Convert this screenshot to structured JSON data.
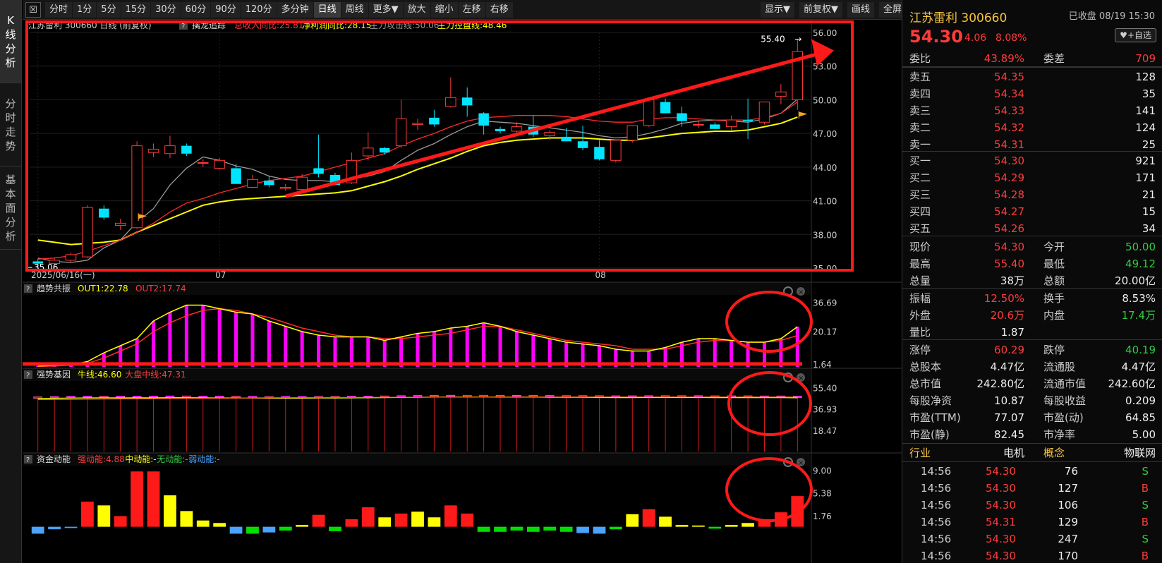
{
  "sidetabs": [
    {
      "label": "K线分析",
      "chars": [
        "K",
        "线",
        "分",
        "析"
      ],
      "active": true
    },
    {
      "label": "分时走势",
      "chars": [
        "分",
        "时",
        "走",
        "势"
      ],
      "active": false
    },
    {
      "label": "基本面分析",
      "chars": [
        "基",
        "本",
        "面",
        "分",
        "析"
      ],
      "active": false
    }
  ],
  "toolbar": {
    "left": [
      "分时",
      "1分",
      "5分",
      "15分",
      "30分",
      "60分",
      "90分",
      "120分",
      "多分钟",
      "日线",
      "周线",
      "更多▼",
      "放大",
      "缩小",
      "左移",
      "右移"
    ],
    "active": "日线",
    "right": [
      "显示▼",
      "前复权▼",
      "画线",
      "全屏"
    ]
  },
  "main": {
    "title": "江苏雷利 300660 日线 (前复权)",
    "indicator_name": "擒龙追踪",
    "indicator_items": [
      {
        "label": "总收入同比:25.81",
        "color": "#ff3b3b"
      },
      {
        "label": "净利润同比:28.15",
        "color": "#ffff00"
      },
      {
        "label": "主力攻击线:50.06",
        "color": "#999999"
      },
      {
        "label": "主力控盘线:48.46",
        "color": "#ffff00"
      }
    ],
    "price_axis": [
      "56.00",
      "53.00",
      "50.00",
      "47.00",
      "44.00",
      "41.00",
      "38.00",
      "35.00"
    ],
    "high_label": "55.40",
    "low_label": "35.06",
    "date_labels": [
      "2025/06/16(一)",
      "07",
      "08"
    ]
  },
  "panel1": {
    "name": "趋势共振",
    "items": [
      {
        "label": "OUT1:22.78",
        "color": "#ffff00"
      },
      {
        "label": "OUT2:17.74",
        "color": "#ff3b3b"
      }
    ],
    "axis": [
      "36.69",
      "20.17",
      "1.64"
    ]
  },
  "panel2": {
    "name": "强势基因",
    "items": [
      {
        "label": "牛线:46.60",
        "color": "#ffff00"
      },
      {
        "label": "大盘中线:47.31",
        "color": "#ff3b3b"
      }
    ],
    "axis": [
      "55.40",
      "36.93",
      "18.47"
    ]
  },
  "panel3": {
    "name": "资金动能",
    "items": [
      {
        "label": "强动能:4.88",
        "color": "#ff3b3b"
      },
      {
        "label": "中动能:-",
        "color": "#ffff00"
      },
      {
        "label": "无动能:-",
        "color": "#2ecc40"
      },
      {
        "label": "弱动能:-",
        "color": "#4aa3ff"
      }
    ],
    "axis": [
      "9.00",
      "5.38",
      "1.76"
    ]
  },
  "chart_data": [
    {
      "type": "candlestick",
      "title": "江苏雷利 300660 日线 (前复权)",
      "ylim": [
        35.0,
        56.0
      ],
      "ohlc": [
        [
          35.6,
          35.8,
          35.06,
          35.4
        ],
        [
          35.4,
          35.9,
          35.1,
          35.7
        ],
        [
          35.7,
          36.4,
          35.5,
          36.2
        ],
        [
          36.0,
          40.6,
          35.9,
          40.4
        ],
        [
          40.3,
          40.6,
          39.3,
          39.5
        ],
        [
          38.8,
          39.4,
          38.4,
          39.0
        ],
        [
          38.6,
          46.3,
          38.5,
          45.9
        ],
        [
          45.3,
          46.1,
          44.9,
          45.6
        ],
        [
          45.2,
          46.8,
          44.8,
          45.9
        ],
        [
          45.9,
          46.1,
          45.0,
          45.2
        ],
        [
          44.4,
          44.7,
          44.0,
          44.4
        ],
        [
          43.9,
          44.8,
          43.8,
          44.6
        ],
        [
          43.9,
          44.3,
          42.6,
          42.5
        ],
        [
          42.2,
          43.3,
          42.1,
          42.9
        ],
        [
          42.8,
          43.2,
          42.2,
          42.4
        ],
        [
          42.1,
          42.5,
          41.9,
          42.2
        ],
        [
          42.0,
          43.4,
          41.9,
          43.1
        ],
        [
          43.9,
          46.9,
          43.1,
          43.4
        ],
        [
          43.3,
          43.5,
          42.5,
          42.4
        ],
        [
          42.6,
          45.3,
          42.5,
          44.6
        ],
        [
          45.0,
          47.1,
          44.6,
          45.7
        ],
        [
          45.7,
          45.8,
          45.1,
          45.3
        ],
        [
          45.9,
          50.0,
          45.7,
          48.3
        ],
        [
          47.8,
          48.3,
          47.3,
          47.9
        ],
        [
          48.4,
          49.1,
          47.6,
          47.8
        ],
        [
          49.4,
          52.0,
          49.3,
          50.2
        ],
        [
          50.2,
          51.1,
          48.5,
          49.5
        ],
        [
          48.8,
          48.9,
          46.9,
          47.7
        ],
        [
          47.4,
          47.6,
          47.0,
          47.2
        ],
        [
          47.2,
          48.0,
          47.0,
          47.6
        ],
        [
          47.6,
          48.6,
          46.7,
          46.9
        ],
        [
          46.8,
          47.3,
          46.4,
          47.1
        ],
        [
          46.7,
          47.5,
          46.3,
          46.3
        ],
        [
          46.3,
          47.7,
          45.5,
          45.7
        ],
        [
          45.8,
          46.4,
          44.6,
          44.7
        ],
        [
          44.6,
          46.4,
          44.4,
          46.4
        ],
        [
          46.4,
          47.6,
          46.2,
          47.7
        ],
        [
          47.7,
          50.0,
          47.6,
          50.0
        ],
        [
          49.8,
          50.1,
          48.9,
          48.8
        ],
        [
          48.8,
          49.4,
          47.6,
          48.1
        ],
        [
          47.8,
          48.2,
          47.5,
          47.8
        ],
        [
          47.8,
          48.0,
          47.4,
          47.4
        ],
        [
          47.6,
          48.6,
          47.3,
          48.2
        ],
        [
          48.2,
          50.1,
          46.5,
          48.1
        ],
        [
          48.0,
          49.8,
          47.8,
          49.8
        ],
        [
          50.3,
          51.4,
          49.6,
          50.7
        ],
        [
          50.0,
          55.4,
          49.1,
          54.3
        ]
      ],
      "series": [
        {
          "name": "主力攻击线",
          "values": [
            35.9,
            35.6,
            35.5,
            35.7,
            36.8,
            37.5,
            39.1,
            40.3,
            42.4,
            43.9,
            44.9,
            44.6,
            44.1,
            43.8,
            43.2,
            42.9,
            42.8,
            42.8,
            42.7,
            43.0,
            43.2,
            43.6,
            44.6,
            45.5,
            46.1,
            46.9,
            47.6,
            48.1,
            48.0,
            47.9,
            47.7,
            47.5,
            47.3,
            47.1,
            46.8,
            46.6,
            46.7,
            47.0,
            47.4,
            47.9,
            48.1,
            48.2,
            48.1,
            48.0,
            48.3,
            48.8,
            50.06
          ]
        },
        {
          "name": "主力控盘线",
          "values": [
            37.5,
            37.3,
            37.1,
            37.2,
            37.3,
            37.5,
            38.2,
            38.8,
            39.4,
            40.0,
            40.6,
            40.9,
            41.1,
            41.2,
            41.3,
            41.4,
            41.5,
            41.6,
            41.7,
            41.9,
            42.3,
            42.7,
            43.2,
            43.8,
            44.3,
            44.8,
            45.4,
            45.9,
            46.2,
            46.4,
            46.5,
            46.6,
            46.6,
            46.6,
            46.5,
            46.4,
            46.4,
            46.6,
            46.8,
            47.0,
            47.1,
            47.2,
            47.2,
            47.3,
            47.6,
            47.9,
            48.46
          ]
        },
        {
          "name": "趋势线",
          "values": [
            35.8,
            35.9,
            36.1,
            36.5,
            37.0,
            37.5,
            38.2,
            39.0,
            40.0,
            40.8,
            41.2,
            41.7,
            42.1,
            42.5,
            42.8,
            43.0,
            43.2,
            43.6,
            44.0,
            44.4,
            44.8,
            45.2,
            45.9,
            46.5,
            47.0,
            47.6,
            48.1,
            48.4,
            48.5,
            48.6,
            48.6,
            48.6,
            48.5,
            48.3,
            48.1,
            48.0,
            48.0,
            48.3,
            48.4,
            48.4,
            48.3,
            48.2,
            48.2,
            48.2,
            48.4,
            48.8,
            49.8
          ]
        }
      ]
    },
    {
      "type": "bar",
      "title": "趋势共振",
      "ylim": [
        0,
        40
      ],
      "series": [
        {
          "name": "OUT1",
          "values": [
            0.5,
            0.8,
            1.2,
            3,
            8,
            12,
            16,
            26,
            31,
            35,
            35,
            33,
            31,
            30,
            26,
            23,
            20,
            18,
            17,
            17,
            17,
            15,
            17,
            19,
            20,
            22,
            23,
            25,
            23,
            20,
            18,
            16,
            14,
            13,
            12,
            10,
            9,
            9,
            11,
            14,
            16,
            16,
            15,
            14,
            14,
            16,
            22.78
          ]
        },
        {
          "name": "OUT2",
          "values": [
            0.2,
            0.5,
            0.9,
            2,
            5,
            9,
            13,
            20,
            25,
            29,
            32,
            33,
            32,
            30,
            28,
            25,
            22,
            20,
            18,
            17,
            17,
            16,
            16,
            17,
            18,
            19,
            21,
            23,
            23,
            21,
            19,
            17,
            15,
            14,
            13,
            12,
            10,
            10,
            10,
            12,
            14,
            15,
            15,
            14,
            14,
            15,
            17.74
          ]
        }
      ]
    },
    {
      "type": "bar",
      "title": "强势基因",
      "ylim": [
        0,
        60
      ],
      "series": [
        {
          "name": "牛线",
          "values": [
            46,
            46.2,
            46.4,
            46.5,
            46.6,
            46.5,
            46.6,
            46.6,
            46.7,
            46.7,
            46.6,
            46.5,
            46.5,
            46.4,
            46.3,
            46.3,
            46.3,
            46.4,
            46.4,
            46.5,
            46.6,
            46.7,
            46.9,
            47.1,
            47.2,
            47.3,
            47.3,
            47.3,
            47.2,
            47.2,
            47.2,
            47.1,
            47,
            47,
            46.9,
            46.8,
            46.8,
            46.9,
            46.9,
            46.9,
            46.9,
            46.8,
            46.8,
            46.8,
            46.7,
            46.7,
            46.6
          ]
        },
        {
          "name": "大盘中线",
          "values": [
            45,
            45.1,
            45.2,
            45.4,
            45.6,
            45.7,
            45.8,
            45.9,
            46,
            46.1,
            46.2,
            46.3,
            46.4,
            46.5,
            46.6,
            46.7,
            46.8,
            46.8,
            46.9,
            46.9,
            47,
            47,
            47.1,
            47.1,
            47.2,
            47.2,
            47.2,
            47.3,
            47.3,
            47.3,
            47.3,
            47.3,
            47.3,
            47.3,
            47.3,
            47.3,
            47.3,
            47.3,
            47.3,
            47.3,
            47.3,
            47.3,
            47.3,
            47.3,
            47.3,
            47.3,
            47.31
          ]
        }
      ]
    },
    {
      "type": "bar",
      "title": "资金动能",
      "ylim": [
        -1.5,
        9.5
      ],
      "values": [
        -1.1,
        -0.4,
        -0.2,
        4.0,
        3.4,
        1.7,
        8.8,
        8.8,
        5.0,
        2.5,
        1.0,
        0.6,
        -1.1,
        -1.1,
        -0.9,
        -0.6,
        0.3,
        1.9,
        -0.7,
        1.2,
        3.1,
        1.5,
        2.1,
        2.4,
        1.5,
        3.4,
        2.1,
        -0.8,
        -0.8,
        -0.6,
        -0.8,
        -0.6,
        -0.8,
        -1.0,
        -1.1,
        -0.4,
        2.0,
        2.8,
        1.6,
        0.3,
        0.2,
        -0.3,
        0.3,
        0.6,
        1.1,
        2.3,
        4.88
      ]
    }
  ],
  "quote": {
    "name": "江苏雷利 300660",
    "date": "已收盘 08/19 15:30",
    "fav": "+自选",
    "price": "54.30",
    "change": "4.06",
    "pct": "8.08%",
    "weibi_label": "委比",
    "weibi": "43.89%",
    "weicha_label": "委差",
    "weicha": "709",
    "asks": [
      {
        "label": "卖五",
        "price": "54.35",
        "vol": "128"
      },
      {
        "label": "卖四",
        "price": "54.34",
        "vol": "35"
      },
      {
        "label": "卖三",
        "price": "54.33",
        "vol": "141"
      },
      {
        "label": "卖二",
        "price": "54.32",
        "vol": "124"
      },
      {
        "label": "卖一",
        "price": "54.31",
        "vol": "25"
      }
    ],
    "bids": [
      {
        "label": "买一",
        "price": "54.30",
        "vol": "921"
      },
      {
        "label": "买二",
        "price": "54.29",
        "vol": "171"
      },
      {
        "label": "买三",
        "price": "54.28",
        "vol": "21"
      },
      {
        "label": "买四",
        "price": "54.27",
        "vol": "15"
      },
      {
        "label": "买五",
        "price": "54.26",
        "vol": "34"
      }
    ],
    "stats": [
      {
        "l1": "现价",
        "v1": "54.30",
        "c1": "red",
        "l2": "今开",
        "v2": "50.00",
        "c2": "green"
      },
      {
        "l1": "最高",
        "v1": "55.40",
        "c1": "red",
        "l2": "最低",
        "v2": "49.12",
        "c2": "green"
      },
      {
        "l1": "总量",
        "v1": "38万",
        "c1": "white",
        "l2": "总额",
        "v2": "20.00亿",
        "c2": "white"
      },
      {
        "l1": "振幅",
        "v1": "12.50%",
        "c1": "red",
        "l2": "换手",
        "v2": "8.53%",
        "c2": "white"
      },
      {
        "l1": "外盘",
        "v1": "20.6万",
        "c1": "red",
        "l2": "内盘",
        "v2": "17.4万",
        "c2": "green"
      },
      {
        "l1": "量比",
        "v1": "1.87",
        "c1": "white",
        "l2": "",
        "v2": "",
        "c2": "white"
      },
      {
        "l1": "涨停",
        "v1": "60.29",
        "c1": "red",
        "l2": "跌停",
        "v2": "40.19",
        "c2": "green"
      },
      {
        "l1": "总股本",
        "v1": "4.47亿",
        "c1": "white",
        "l2": "流通股",
        "v2": "4.47亿",
        "c2": "white"
      },
      {
        "l1": "总市值",
        "v1": "242.80亿",
        "c1": "white",
        "l2": "流通市值",
        "v2": "242.60亿",
        "c2": "white"
      },
      {
        "l1": "每股净资",
        "v1": "10.87",
        "c1": "white",
        "l2": "每股收益",
        "v2": "0.209",
        "c2": "white"
      },
      {
        "l1": "市盈(TTM)",
        "v1": "77.07",
        "c1": "white",
        "l2": "市盈(动)",
        "v2": "64.85",
        "c2": "white"
      },
      {
        "l1": "市盈(静)",
        "v1": "82.45",
        "c1": "white",
        "l2": "市净率",
        "v2": "5.00",
        "c2": "white"
      }
    ],
    "industry_label": "行业",
    "industry": "电机",
    "concept_label": "概念",
    "concept": "物联网",
    "ticks": [
      {
        "time": "14:56",
        "price": "54.30",
        "vol": "76",
        "side": "S"
      },
      {
        "time": "14:56",
        "price": "54.30",
        "vol": "127",
        "side": "B"
      },
      {
        "time": "14:56",
        "price": "54.30",
        "vol": "106",
        "side": "S"
      },
      {
        "time": "14:56",
        "price": "54.31",
        "vol": "129",
        "side": "B"
      },
      {
        "time": "14:56",
        "price": "54.30",
        "vol": "247",
        "side": "S"
      },
      {
        "time": "14:56",
        "price": "54.30",
        "vol": "170",
        "side": "B"
      }
    ]
  }
}
